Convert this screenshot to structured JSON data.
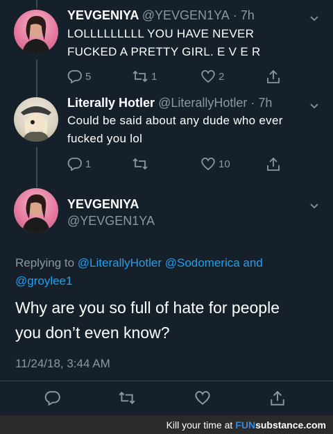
{
  "tweets": [
    {
      "name": "YEVGENIYA",
      "handle": "@YEVGEN1YA",
      "time": "7h",
      "text_lines": [
        "LOLLLLLLLLL YOU HAVE NEVER",
        "FUCKED A PRETTY GIRL. E V E R"
      ],
      "replies": "5",
      "retweets": "1",
      "likes": "2"
    },
    {
      "name": "Literally Hotler",
      "handle": "@LiterallyHotler",
      "time": "7h",
      "text_lines": [
        "Could be said about any dude who ever",
        "fucked you lol"
      ],
      "replies": "1",
      "retweets": "",
      "likes": "10"
    }
  ],
  "main_tweet": {
    "name": "YEVGENIYA",
    "handle": "@YEVGEN1YA",
    "replying_prefix": "Replying to",
    "replying_link1": "@LiterallyHotler",
    "replying_link2": "@Sodomerica",
    "replying_and": "and",
    "replying_link3": "@groylee1",
    "text_lines": [
      "Why are you so full of hate for people",
      "you don’t even know?"
    ],
    "timestamp": "11/24/18, 3:44 AM"
  },
  "footer": {
    "prefix": "Kill your time at",
    "brand_fun": "FUN",
    "brand_rest": "substance",
    "brand_tld": ".com"
  },
  "colors": {
    "background": "#15202b",
    "muted": "#8899a6",
    "link": "#1da1f2"
  }
}
